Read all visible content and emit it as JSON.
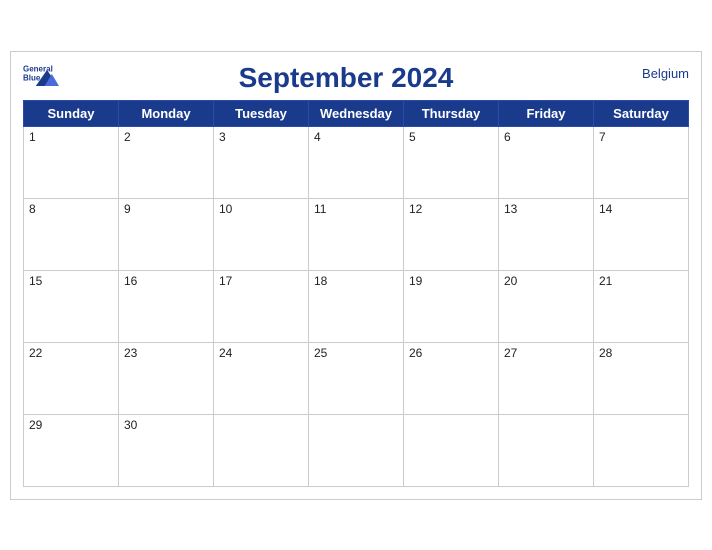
{
  "header": {
    "title": "September 2024",
    "country": "Belgium",
    "logo_line1": "General",
    "logo_line2": "Blue"
  },
  "days_of_week": [
    "Sunday",
    "Monday",
    "Tuesday",
    "Wednesday",
    "Thursday",
    "Friday",
    "Saturday"
  ],
  "weeks": [
    [
      {
        "date": "1",
        "active": true
      },
      {
        "date": "2",
        "active": true
      },
      {
        "date": "3",
        "active": true
      },
      {
        "date": "4",
        "active": true
      },
      {
        "date": "5",
        "active": true
      },
      {
        "date": "6",
        "active": true
      },
      {
        "date": "7",
        "active": true
      }
    ],
    [
      {
        "date": "8",
        "active": true
      },
      {
        "date": "9",
        "active": true
      },
      {
        "date": "10",
        "active": true
      },
      {
        "date": "11",
        "active": true
      },
      {
        "date": "12",
        "active": true
      },
      {
        "date": "13",
        "active": true
      },
      {
        "date": "14",
        "active": true
      }
    ],
    [
      {
        "date": "15",
        "active": true
      },
      {
        "date": "16",
        "active": true
      },
      {
        "date": "17",
        "active": true
      },
      {
        "date": "18",
        "active": true
      },
      {
        "date": "19",
        "active": true
      },
      {
        "date": "20",
        "active": true
      },
      {
        "date": "21",
        "active": true
      }
    ],
    [
      {
        "date": "22",
        "active": true
      },
      {
        "date": "23",
        "active": true
      },
      {
        "date": "24",
        "active": true
      },
      {
        "date": "25",
        "active": true
      },
      {
        "date": "26",
        "active": true
      },
      {
        "date": "27",
        "active": true
      },
      {
        "date": "28",
        "active": true
      }
    ],
    [
      {
        "date": "29",
        "active": true
      },
      {
        "date": "30",
        "active": true
      },
      {
        "date": "",
        "active": false
      },
      {
        "date": "",
        "active": false
      },
      {
        "date": "",
        "active": false
      },
      {
        "date": "",
        "active": false
      },
      {
        "date": "",
        "active": false
      }
    ]
  ],
  "colors": {
    "header_bg": "#1a3a8c",
    "header_text": "#ffffff",
    "border": "#cccccc"
  }
}
